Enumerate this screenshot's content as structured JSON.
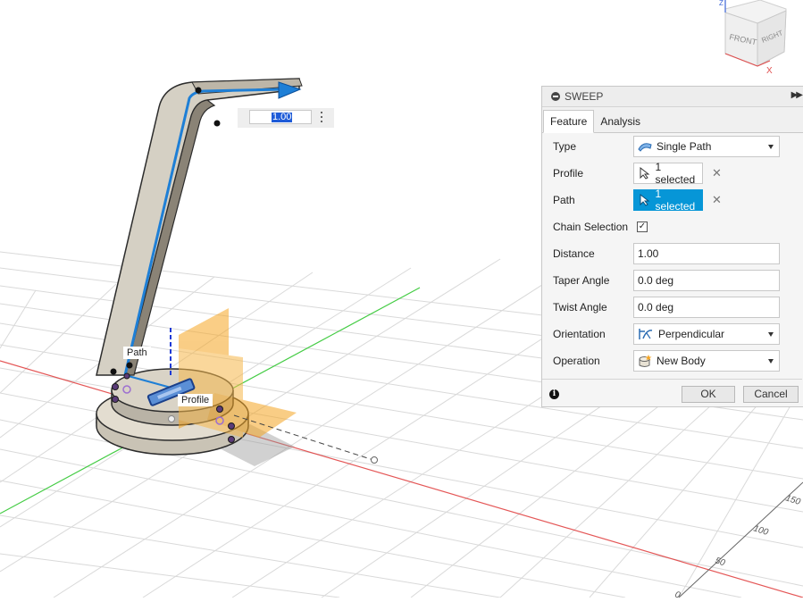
{
  "viewport": {
    "grid_labels": [
      "150",
      "100",
      "50",
      "0"
    ],
    "viewcube": {
      "front": "FRONT",
      "right": "RIGHT",
      "axis_x": "X",
      "axis_z": "Z"
    },
    "callouts": {
      "path": "Path",
      "profile": "Profile"
    },
    "distance_input": {
      "value": "1.00"
    }
  },
  "dialog": {
    "title": "SWEEP",
    "tabs": [
      {
        "label": "Feature"
      },
      {
        "label": "Analysis"
      }
    ],
    "rows": {
      "type": {
        "label": "Type",
        "value": "Single Path",
        "icon": "single-path-icon"
      },
      "profile": {
        "label": "Profile",
        "value": "1 selected",
        "icon": "cursor-icon"
      },
      "path": {
        "label": "Path",
        "value": "1 selected",
        "icon": "cursor-icon"
      },
      "chain_selection": {
        "label": "Chain Selection",
        "checked": true
      },
      "distance": {
        "label": "Distance",
        "value": "1.00"
      },
      "taper_angle": {
        "label": "Taper Angle",
        "value": "0.0 deg"
      },
      "twist_angle": {
        "label": "Twist Angle",
        "value": "0.0 deg"
      },
      "orientation": {
        "label": "Orientation",
        "value": "Perpendicular",
        "icon": "perpendicular-icon"
      },
      "operation": {
        "label": "Operation",
        "value": "New Body",
        "icon": "new-body-icon"
      }
    },
    "buttons": {
      "ok": "OK",
      "cancel": "Cancel"
    }
  },
  "colors": {
    "accent": "#0696d7",
    "path_blue": "#1e7fd6",
    "profile_orange": "#f5a623",
    "grid_green": "#33cc33",
    "grid_red": "#dd2222"
  }
}
